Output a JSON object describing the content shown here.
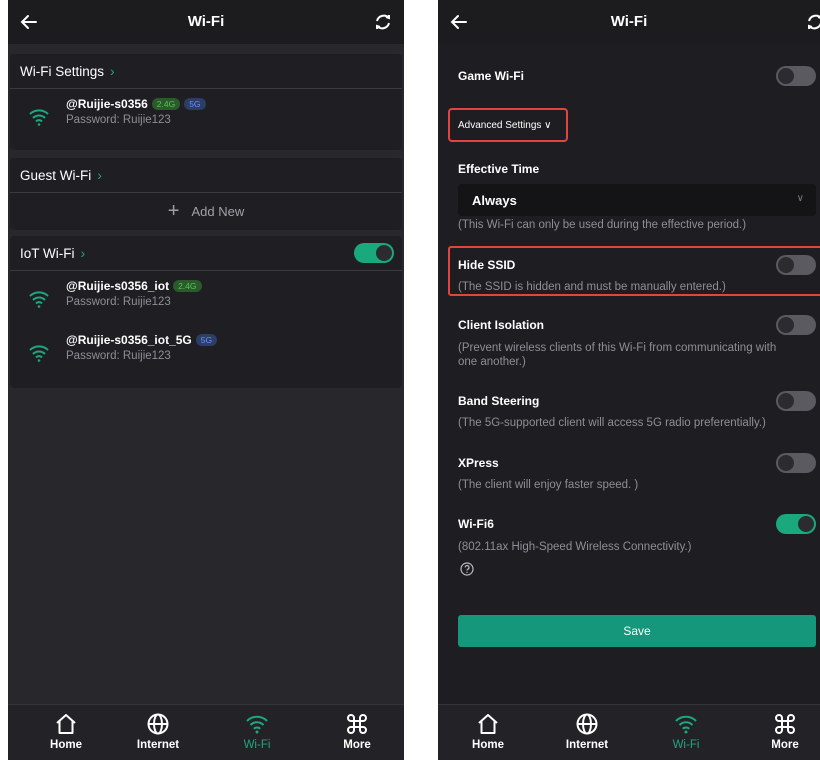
{
  "left": {
    "title": "Wi-Fi",
    "wifi_settings": {
      "label": "Wi-Fi Settings",
      "ssid": "@Ruijie-s0356",
      "badge_24": "2.4G",
      "badge_5": "5G",
      "password": "Password: Ruijie123"
    },
    "guest": {
      "label": "Guest Wi-Fi",
      "add_new": "Add New"
    },
    "iot": {
      "label": "IoT Wi-Fi",
      "enabled": true,
      "networks": [
        {
          "ssid": "@Ruijie-s0356_iot",
          "badge": "2.4G",
          "password": "Password: Ruijie123"
        },
        {
          "ssid": "@Ruijie-s0356_iot_5G",
          "badge": "5G",
          "password": "Password: Ruijie123"
        }
      ]
    }
  },
  "right": {
    "title": "Wi-Fi",
    "game_wifi": "Game Wi-Fi",
    "advanced_settings": "Advanced Settings ∨",
    "effective_time": {
      "label": "Effective Time",
      "value": "Always",
      "hint": "(This Wi-Fi can only be used during the effective period.)"
    },
    "hide_ssid": {
      "label": "Hide SSID",
      "hint": "(The SSID is hidden and must be manually entered.)"
    },
    "client_isolation": {
      "label": "Client Isolation",
      "hint": "(Prevent wireless clients of this Wi-Fi from communicating with one another.)"
    },
    "band_steering": {
      "label": "Band Steering",
      "hint": "(The 5G-supported client will access 5G radio preferentially.)"
    },
    "xpress": {
      "label": "XPress",
      "hint": "(The client will enjoy faster speed. )"
    },
    "wifi6": {
      "label": "Wi-Fi6",
      "hint": "(802.11ax High-Speed Wireless Connectivity.)",
      "enabled": true
    },
    "save": "Save"
  },
  "tabs": [
    "Home",
    "Internet",
    "Wi-Fi",
    "More"
  ],
  "active_tab": "Wi-Fi",
  "colors": {
    "accent": "#1ea67f",
    "highlight_box": "#e0463e",
    "background": "#28282c"
  }
}
